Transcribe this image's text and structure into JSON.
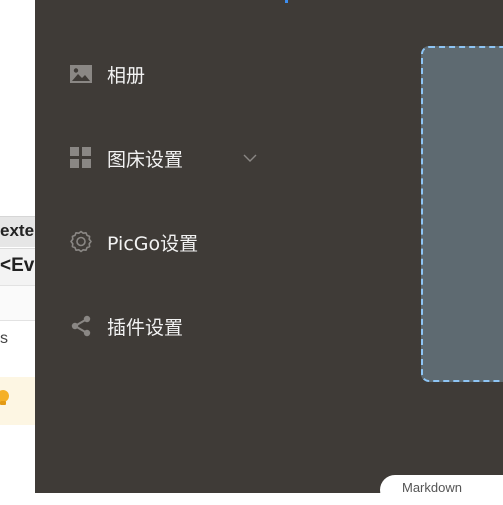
{
  "background_page": {
    "row1_text": "exte",
    "row2_text": "<Ev",
    "row4_text": "s",
    "hint_icon": "lightbulb-icon"
  },
  "sidebar": {
    "items": [
      {
        "label": "相册",
        "icon": "image-icon"
      },
      {
        "label": "图床设置",
        "icon": "grid-icon",
        "expand_icon": "chevron-down-icon"
      },
      {
        "label": "PicGo设置",
        "icon": "gear-icon"
      },
      {
        "label": "插件设置",
        "icon": "share-icon"
      }
    ]
  },
  "main": {
    "format_pill_label": "Markdown"
  },
  "colors": {
    "app_bg": "#3f3b37",
    "accent": "#3d8ef0",
    "upload_border": "#8ec5f5",
    "upload_bg": "#5e6a71",
    "hint_bg": "#fdf6e3"
  }
}
